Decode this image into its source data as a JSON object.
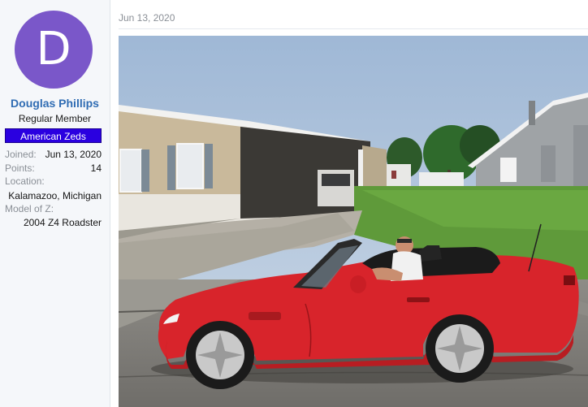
{
  "author": {
    "avatar_letter": "D",
    "avatar_color": "#7a57c9",
    "name": "Douglas Phillips",
    "title": "Regular Member",
    "banner": "American Zeds",
    "stats": {
      "joined_label": "Joined:",
      "joined_value": "Jun 13, 2020",
      "points_label": "Points:",
      "points_value": "14",
      "location_label": "Location:",
      "location_value": "Kalamazoo, Michigan",
      "model_label": "Model of Z:",
      "model_value": "2004 Z4 Roadster"
    }
  },
  "post": {
    "date": "Jun 13, 2020",
    "attachment_icon": "photo-image"
  },
  "colors": {
    "username": "#2f6cb3",
    "banner_bg": "#2a00e0",
    "car_red": "#d8242b"
  }
}
